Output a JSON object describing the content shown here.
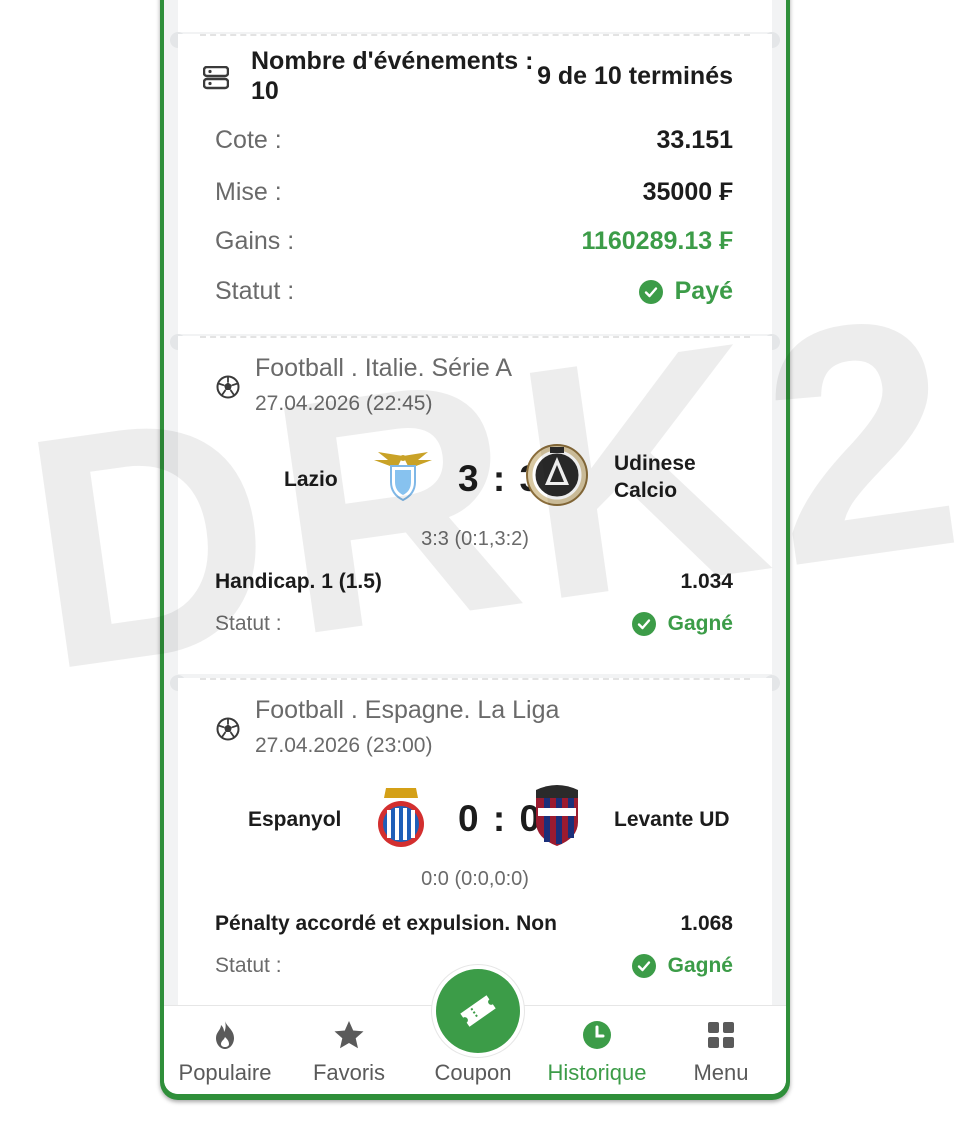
{
  "summary": {
    "events_label": "Nombre d'événements : 10",
    "events_value": "9 de 10 terminés",
    "cote_label": "Cote :",
    "cote_value": "33.151",
    "mise_label": "Mise :",
    "mise_value": "35000 ₣",
    "gains_label": "Gains :",
    "gains_value": "1160289.13 ₣",
    "statut_label": "Statut :",
    "statut_value": "Payé"
  },
  "events": [
    {
      "league": "Football . Italie. Série A",
      "datetime": "27.04.2026 (22:45)",
      "home": "Lazio",
      "away": "Udinese Calcio",
      "score": "3 : 3",
      "detail": "3:3 (0:1,3:2)",
      "bet": "Handicap. 1 (1.5)",
      "odds": "1.034",
      "status_label": "Statut :",
      "status": "Gagné"
    },
    {
      "league": "Football . Espagne. La Liga",
      "datetime": "27.04.2026 (23:00)",
      "home": "Espanyol",
      "away": "Levante UD",
      "score": "0 : 0",
      "detail": "0:0 (0:0,0:0)",
      "bet": "Pénalty accordé et expulsion. Non",
      "odds": "1.068",
      "status_label": "Statut :",
      "status": "Gagné"
    }
  ],
  "nav": {
    "populaire": "Populaire",
    "favoris": "Favoris",
    "coupon": "Coupon",
    "historique": "Historique",
    "menu": "Menu"
  },
  "watermark": "DRK2",
  "colors": {
    "accent": "#3c9c48",
    "frame": "#2f8f3a"
  }
}
